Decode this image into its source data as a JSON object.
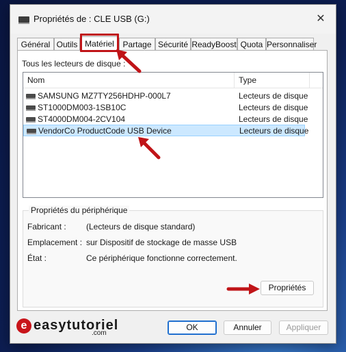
{
  "window": {
    "title": "Propriétés de : CLE USB (G:)"
  },
  "tabs": [
    {
      "label": "Général"
    },
    {
      "label": "Outils"
    },
    {
      "label": "Matériel"
    },
    {
      "label": "Partage"
    },
    {
      "label": "Sécurité"
    },
    {
      "label": "ReadyBoost"
    },
    {
      "label": "Quota"
    },
    {
      "label": "Personnaliser"
    }
  ],
  "active_tab": "Matériel",
  "disk_list": {
    "label": "Tous les lecteurs de disque :",
    "columns": {
      "name": "Nom",
      "type": "Type"
    },
    "rows": [
      {
        "name": "SAMSUNG MZ7TY256HDHP-000L7",
        "type": "Lecteurs de disque"
      },
      {
        "name": "ST1000DM003-1SB10C",
        "type": "Lecteurs de disque"
      },
      {
        "name": "ST4000DM004-2CV104",
        "type": "Lecteurs de disque"
      },
      {
        "name": "VendorCo ProductCode USB Device",
        "type": "Lecteurs de disque"
      }
    ],
    "selected_index": 3
  },
  "device_properties": {
    "title": "Propriétés du périphérique",
    "manufacturer_label": "Fabricant :",
    "manufacturer_value": "(Lecteurs de disque standard)",
    "location_label": "Emplacement :",
    "location_value": "sur Dispositif de stockage de masse USB",
    "status_label": "État :",
    "status_value": "Ce périphérique fonctionne correctement.",
    "properties_button": "Propriétés"
  },
  "footer": {
    "ok": "OK",
    "cancel": "Annuler",
    "apply": "Appliquer"
  },
  "brand": {
    "name": "easytutoriel",
    "suffix": ".com",
    "logo_letter": "e"
  },
  "colors": {
    "annotation_red": "#c01418",
    "selection": "#cce8ff",
    "default_button": "#1f6fcf"
  }
}
